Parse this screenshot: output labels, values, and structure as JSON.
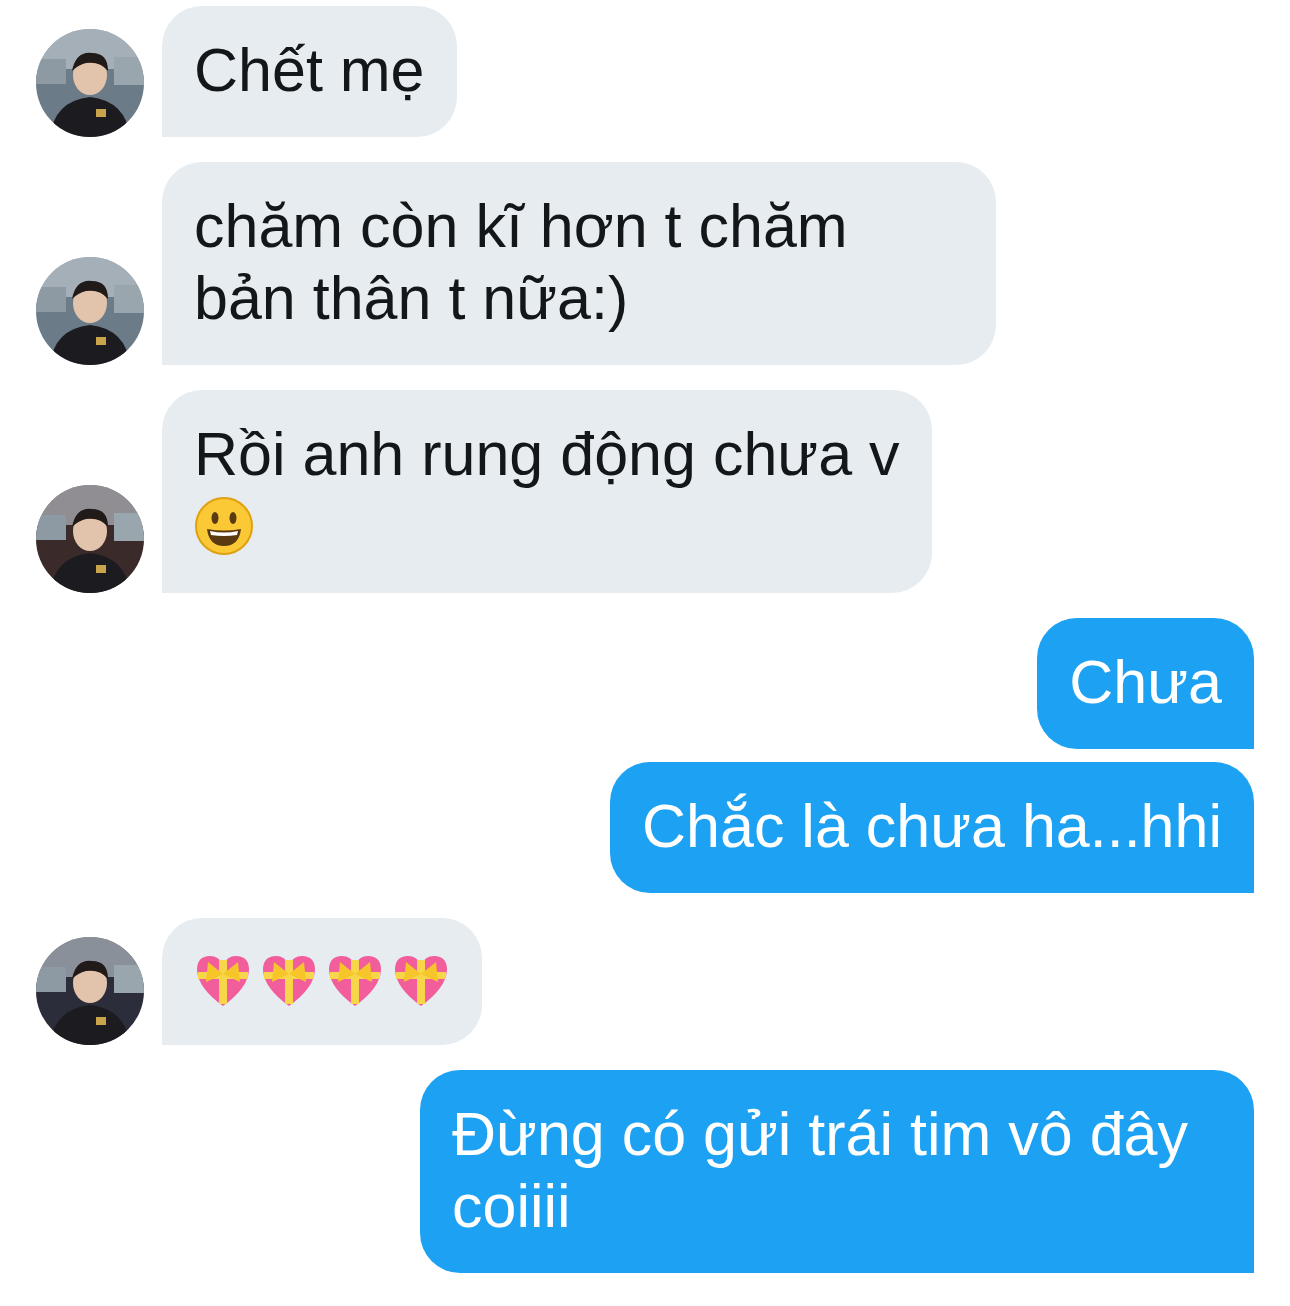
{
  "messages": [
    {
      "kind": "received",
      "text": "Chết mẹ"
    },
    {
      "kind": "received",
      "text": "chăm còn kĩ hơn t chăm bản thân t nữa:)"
    },
    {
      "kind": "received",
      "text": "Rồi anh rung động chưa v",
      "emojis": [
        {
          "kind": "smiley"
        }
      ]
    },
    {
      "kind": "sent",
      "text": "Chưa"
    },
    {
      "kind": "sent",
      "text": "Chắc là chưa ha...hhi"
    },
    {
      "kind": "received",
      "emojis": [
        {
          "kind": "gift-heart"
        },
        {
          "kind": "gift-heart"
        },
        {
          "kind": "gift-heart"
        },
        {
          "kind": "gift-heart"
        }
      ]
    },
    {
      "kind": "sent",
      "text": "Đừng có gửi trái tim vô đây coiiii"
    }
  ]
}
